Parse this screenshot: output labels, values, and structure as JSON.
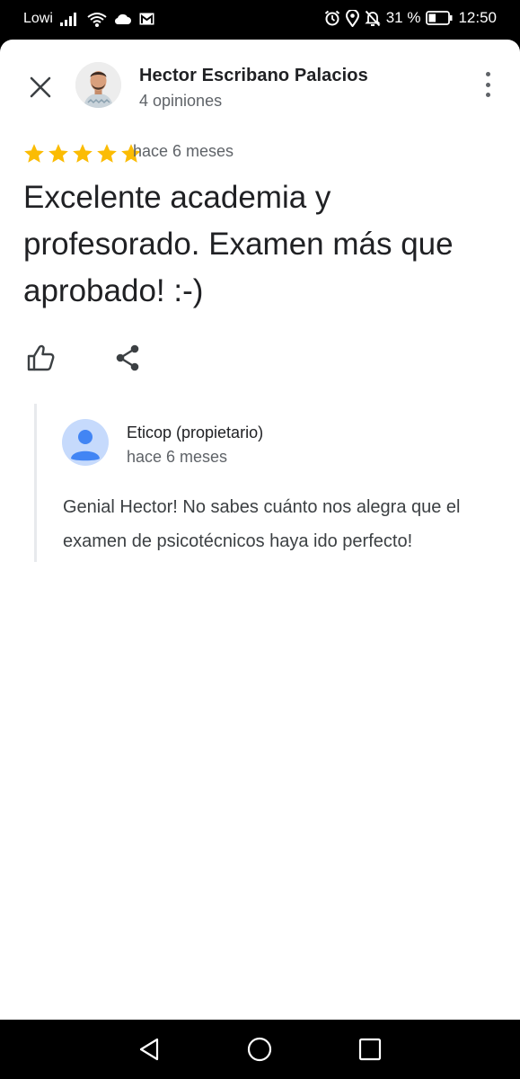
{
  "status_bar": {
    "carrier": "Lowi",
    "battery_percent": "31 %",
    "time": "12:50",
    "icons": [
      "signal-icon",
      "wifi-icon",
      "cloud-icon",
      "gmail-icon",
      "alarm-icon",
      "location-icon",
      "notifications-off-icon",
      "battery-icon"
    ]
  },
  "reviewer": {
    "name": "Hector Escribano Palacios",
    "reviews_count": "4 opiniones"
  },
  "review": {
    "rating": 5,
    "max_rating": 5,
    "time": "hace 6 meses",
    "text": "Excelente academia y profesorado. Examen más que aprobado! :-)"
  },
  "owner_reply": {
    "name": "Eticop (propietario)",
    "time": "hace 6 meses",
    "text": "Genial Hector! No sabes cuánto nos alegra que el examen de psicotécnicos haya ido perfecto!"
  },
  "colors": {
    "star": "#FBBC04",
    "icon": "#3c4043",
    "owner_avatar_bg": "#c6dafc",
    "owner_avatar_fg": "#4285F4"
  },
  "actions": [
    "like-icon",
    "share-icon"
  ],
  "nav_bar": [
    "back-icon",
    "home-icon",
    "recents-icon"
  ]
}
